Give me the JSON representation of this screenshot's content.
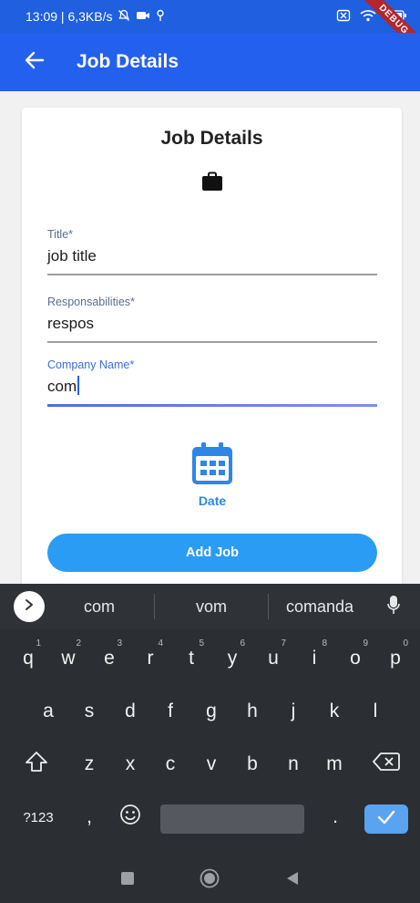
{
  "status_bar": {
    "time_net": "13:09 | 6,3KB/s",
    "icons_left": [
      "bell-off-icon",
      "video-icon",
      "location-icon"
    ],
    "icons_right": [
      "sim-off-icon",
      "wifi-icon",
      "battery-icon"
    ],
    "debug_banner": "DEBUG"
  },
  "app_bar": {
    "title": "Job Details",
    "back_icon": "arrow-left-icon"
  },
  "form": {
    "card_title": "Job Details",
    "header_icon": "briefcase-icon",
    "fields": [
      {
        "label": "Title*",
        "value": "job title"
      },
      {
        "label": "Responsabilities*",
        "value": "respos"
      },
      {
        "label": "Company Name*",
        "value": "com"
      }
    ],
    "date": {
      "icon": "calendar-icon",
      "label": "Date"
    },
    "submit_label": "Add Job",
    "colors": {
      "accent": "#2a9cf3",
      "app_bar": "#2460ee",
      "focus": "#3a6ee0"
    }
  },
  "keyboard": {
    "suggestions": [
      "com",
      "vom",
      "comanda"
    ],
    "row1": [
      {
        "key": "q",
        "hint": "1"
      },
      {
        "key": "w",
        "hint": "2"
      },
      {
        "key": "e",
        "hint": "3"
      },
      {
        "key": "r",
        "hint": "4"
      },
      {
        "key": "t",
        "hint": "5"
      },
      {
        "key": "y",
        "hint": "6"
      },
      {
        "key": "u",
        "hint": "7"
      },
      {
        "key": "i",
        "hint": "8"
      },
      {
        "key": "o",
        "hint": "9"
      },
      {
        "key": "p",
        "hint": "0"
      }
    ],
    "row2": [
      "a",
      "s",
      "d",
      "f",
      "g",
      "h",
      "j",
      "k",
      "l"
    ],
    "row3": [
      "z",
      "x",
      "c",
      "v",
      "b",
      "n",
      "m"
    ],
    "symbols_label": "?123",
    "comma": ",",
    "period": "."
  }
}
